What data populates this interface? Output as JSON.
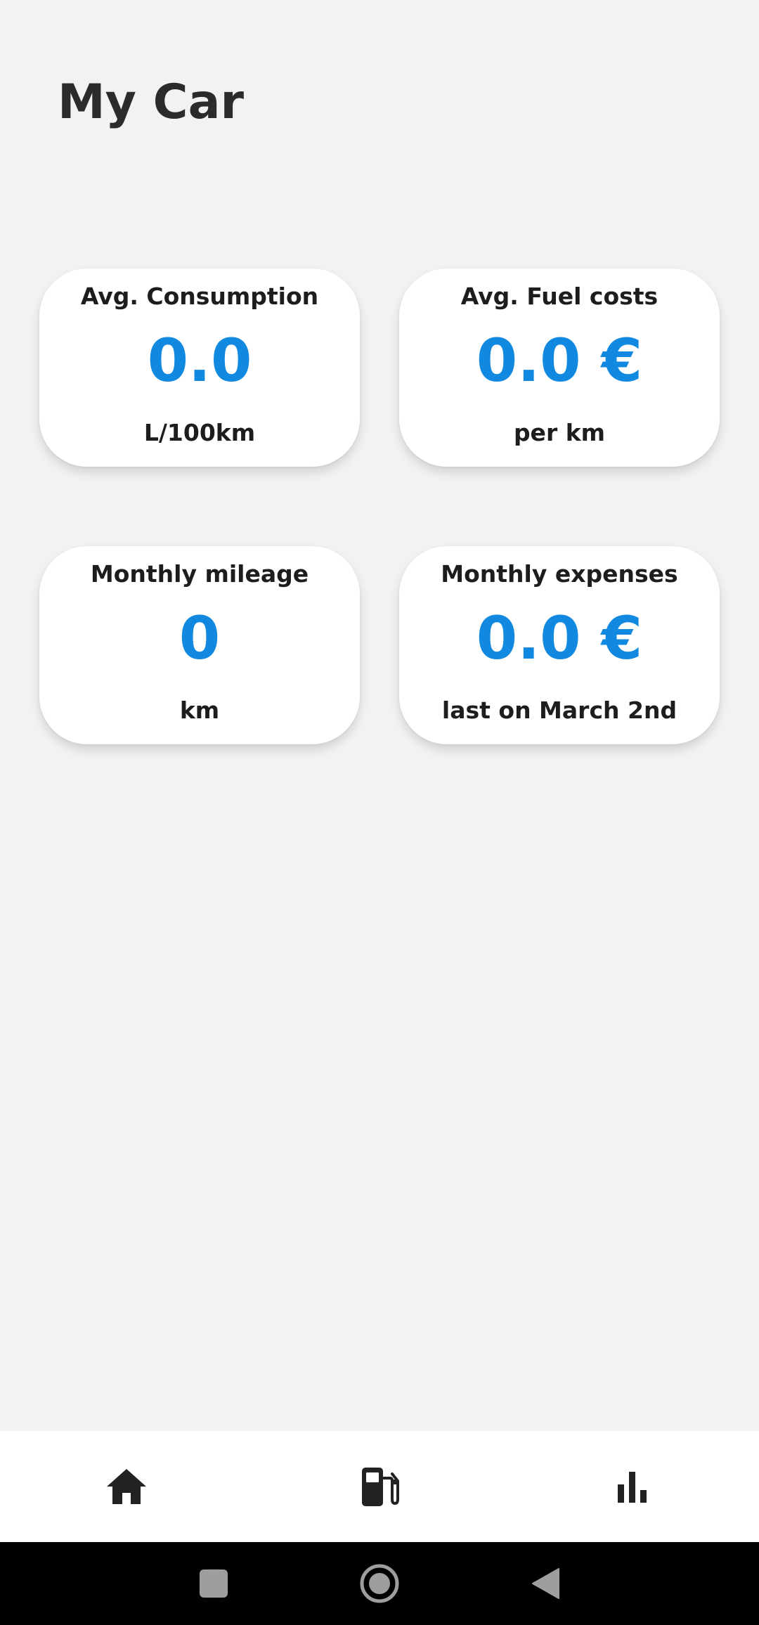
{
  "header": {
    "title": "My Car"
  },
  "cards": [
    {
      "label": "Avg. Consumption",
      "value": "0.0",
      "unit": "L/100km"
    },
    {
      "label": "Avg. Fuel costs",
      "value": "0.0 €",
      "unit": "per km"
    },
    {
      "label": "Monthly mileage",
      "value": "0",
      "unit": "km"
    },
    {
      "label": "Monthly expenses",
      "value": "0.0 €",
      "unit": "last on March 2nd"
    }
  ],
  "bottom_nav": {
    "items": [
      {
        "icon": "home-icon"
      },
      {
        "icon": "fuel-pump-icon"
      },
      {
        "icon": "bar-chart-icon"
      }
    ]
  },
  "system_nav": {
    "buttons": [
      {
        "icon": "recents-square-icon"
      },
      {
        "icon": "home-circle-icon"
      },
      {
        "icon": "back-triangle-icon"
      }
    ]
  },
  "colors": {
    "accent": "#1289e0",
    "background": "#f1f2f2",
    "card": "#ffffff",
    "text": "#1d1d1d"
  }
}
